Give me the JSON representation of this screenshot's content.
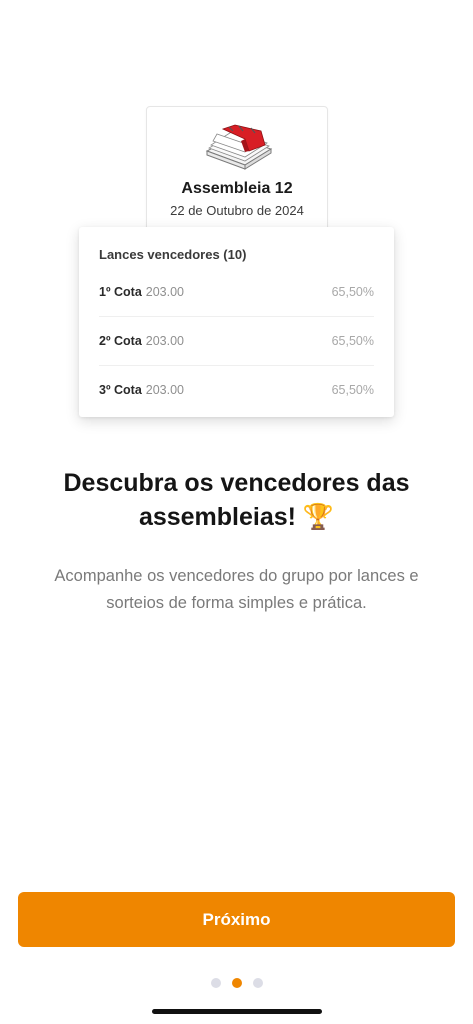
{
  "assembly": {
    "title": "Assembleia 12",
    "date": "22 de Outubro de 2024"
  },
  "winners": {
    "title": "Lances vencedores (10)",
    "rows": [
      {
        "label": "1º Cota",
        "value": "203.00",
        "percent": "65,50%"
      },
      {
        "label": "2º Cota",
        "value": "203.00",
        "percent": "65,50%"
      },
      {
        "label": "3º Cota",
        "value": "203.00",
        "percent": "65,50%"
      }
    ]
  },
  "headline": "Descubra os vencedores das assembleias! 🏆",
  "subtitle": "Acompanhe os vencedores do grupo por lances e sorteios de forma simples e prática.",
  "button": {
    "label": "Próximo"
  },
  "pagination": {
    "total": 3,
    "active": 2
  },
  "colors": {
    "accent": "#ef8600",
    "calendar_red": "#d81e25"
  }
}
